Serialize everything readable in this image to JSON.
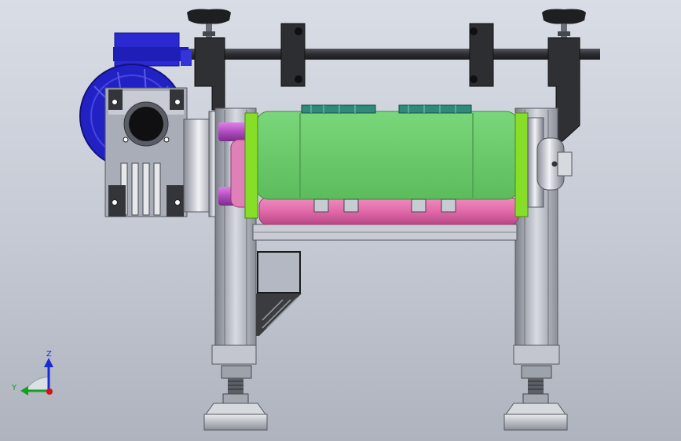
{
  "triad": {
    "z_label": "Z",
    "y_label": "Y",
    "z_color": "#1a2bd6",
    "y_color": "#12a020",
    "x_color": "#d0141a"
  },
  "colors": {
    "motor_blue": "#2424c8",
    "roller_green": "#6ecc6e",
    "roller_pink": "#e06ca8",
    "plate_lime": "#88e028",
    "frame_gray": "#b4b8c4",
    "clamp_dark": "#303236",
    "knob_black": "#222222",
    "stripe_teal": "#2f8a7a"
  }
}
